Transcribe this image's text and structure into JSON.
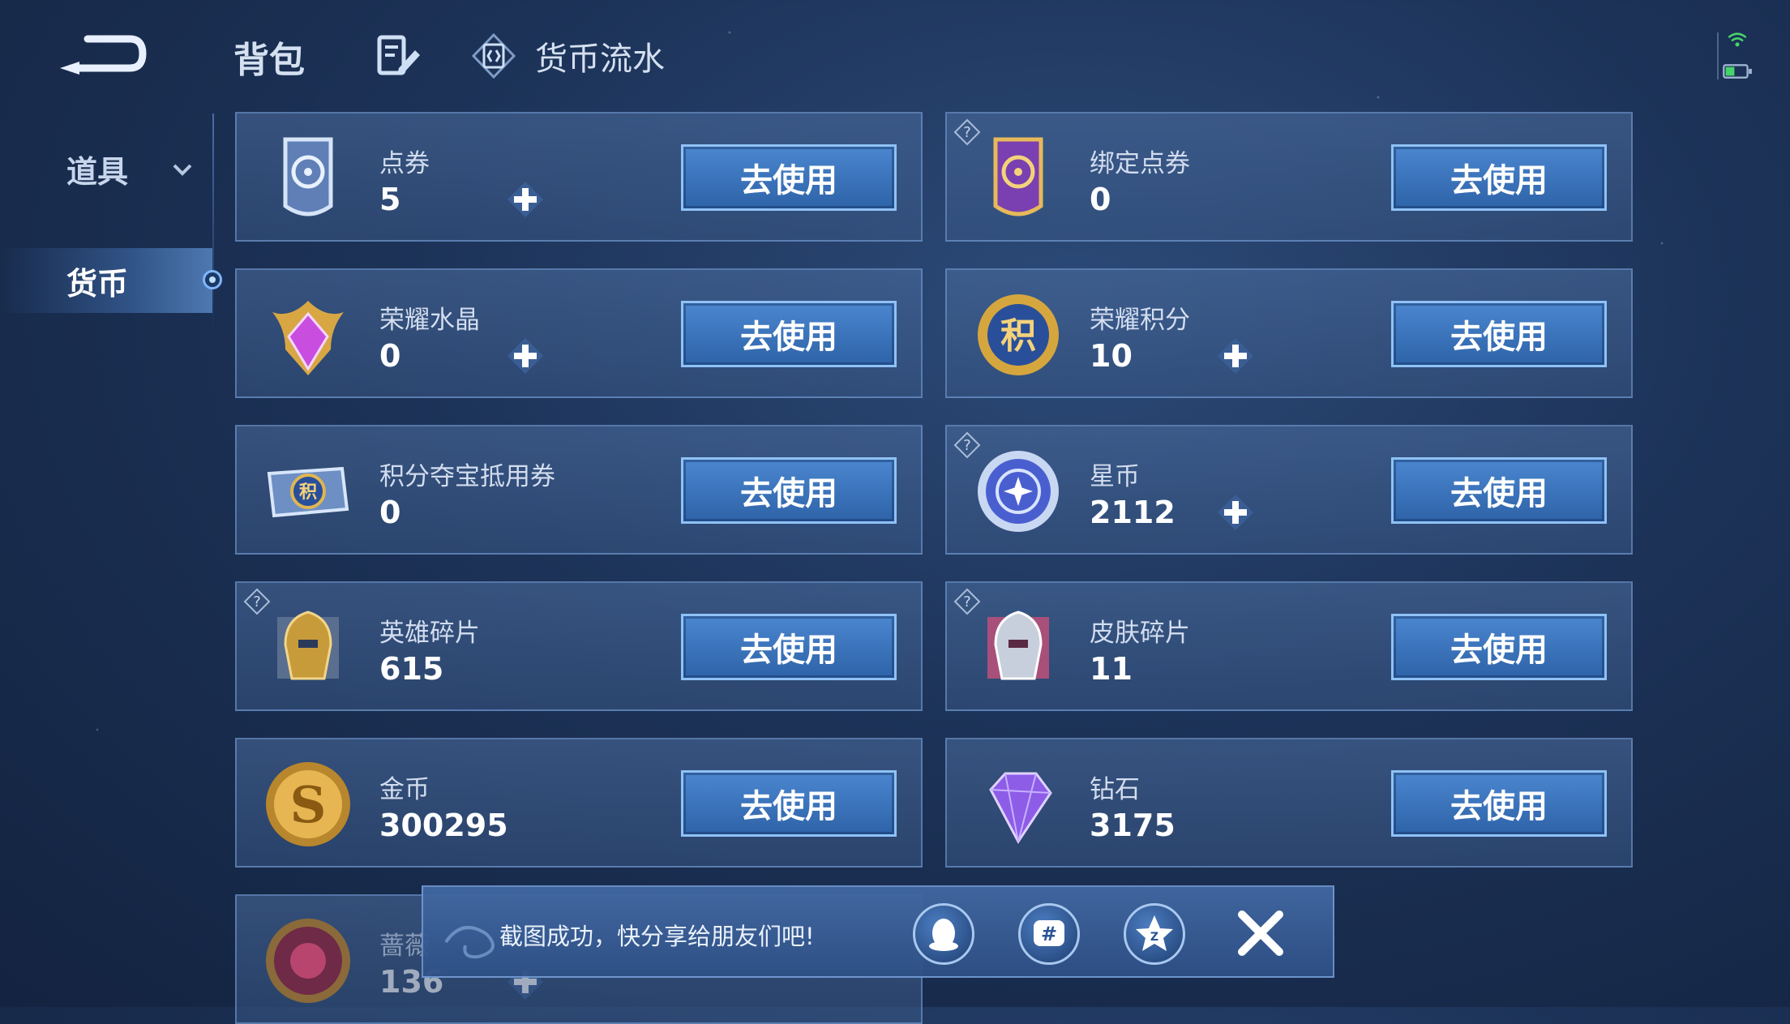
{
  "topbar": {
    "back_icon": "back-arrow-icon",
    "tab_bag": "背包",
    "edit_icon": "edit-list-icon",
    "flow_icon": "currency-flow-icon",
    "flow_label": "货币流水"
  },
  "status": {
    "wifi_icon": "wifi-icon",
    "battery_icon": "battery-icon"
  },
  "sidebar": {
    "items": [
      {
        "label": "道具",
        "icon": "chevron-down-icon"
      },
      {
        "label": "货币",
        "selected": true
      }
    ]
  },
  "cards": [
    {
      "name": "点券",
      "value": "5",
      "icon": "coupon-icon",
      "has_plus": true,
      "has_help": false,
      "button": "去使用"
    },
    {
      "name": "绑定点券",
      "value": "0",
      "icon": "bound-coupon-icon",
      "has_plus": false,
      "has_help": true,
      "button": "去使用"
    },
    {
      "name": "荣耀水晶",
      "value": "0",
      "icon": "glory-crystal-icon",
      "has_plus": true,
      "has_help": false,
      "button": "去使用"
    },
    {
      "name": "荣耀积分",
      "value": "10",
      "icon": "glory-points-icon",
      "has_plus": true,
      "has_help": false,
      "button": "去使用"
    },
    {
      "name": "积分夺宝抵用券",
      "value": "0",
      "icon": "points-voucher-icon",
      "has_plus": false,
      "has_help": false,
      "button": "去使用"
    },
    {
      "name": "星币",
      "value": "2112",
      "icon": "star-coin-icon",
      "has_plus": true,
      "has_help": true,
      "button": "去使用"
    },
    {
      "name": "英雄碎片",
      "value": "615",
      "icon": "hero-fragment-icon",
      "has_plus": false,
      "has_help": true,
      "button": "去使用"
    },
    {
      "name": "皮肤碎片",
      "value": "11",
      "icon": "skin-fragment-icon",
      "has_plus": false,
      "has_help": true,
      "button": "去使用"
    },
    {
      "name": "金币",
      "value": "300295",
      "icon": "gold-coin-icon",
      "has_plus": false,
      "has_help": false,
      "button": "去使用"
    },
    {
      "name": "钻石",
      "value": "3175",
      "icon": "diamond-icon",
      "has_plus": false,
      "has_help": false,
      "button": "去使用"
    },
    {
      "name": "蔷薇",
      "value": "136",
      "icon": "rose-coin-icon",
      "has_plus": true,
      "has_help": false,
      "button": ""
    }
  ],
  "toast": {
    "message": "截图成功，快分享给朋友们吧!",
    "share_icons": [
      "qq-icon",
      "hashtag-icon",
      "qzone-star-icon"
    ],
    "close_icon": "close-icon"
  },
  "colors": {
    "button": "#3a74bd",
    "button_border": "#8fc2f6",
    "accent": "#7fb6ff"
  }
}
